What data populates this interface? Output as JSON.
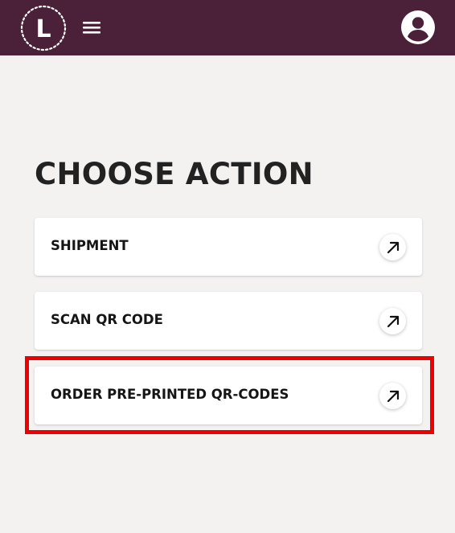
{
  "header": {
    "logo_letter": "L",
    "background": "#4a2139"
  },
  "main": {
    "title": "CHOOSE ACTION",
    "actions": [
      {
        "label": "SHIPMENT",
        "icon": "arrow-up-right-icon"
      },
      {
        "label": "SCAN QR CODE",
        "icon": "arrow-up-right-icon"
      },
      {
        "label": "ORDER PRE-PRINTED QR-CODES",
        "icon": "arrow-up-right-icon"
      }
    ]
  },
  "highlight": {
    "target": "ORDER PRE-PRINTED QR-CODES",
    "color": "#ee0000"
  },
  "colors": {
    "page_background": "#f4f2f1",
    "card_background": "#ffffff",
    "text": "#222222"
  }
}
